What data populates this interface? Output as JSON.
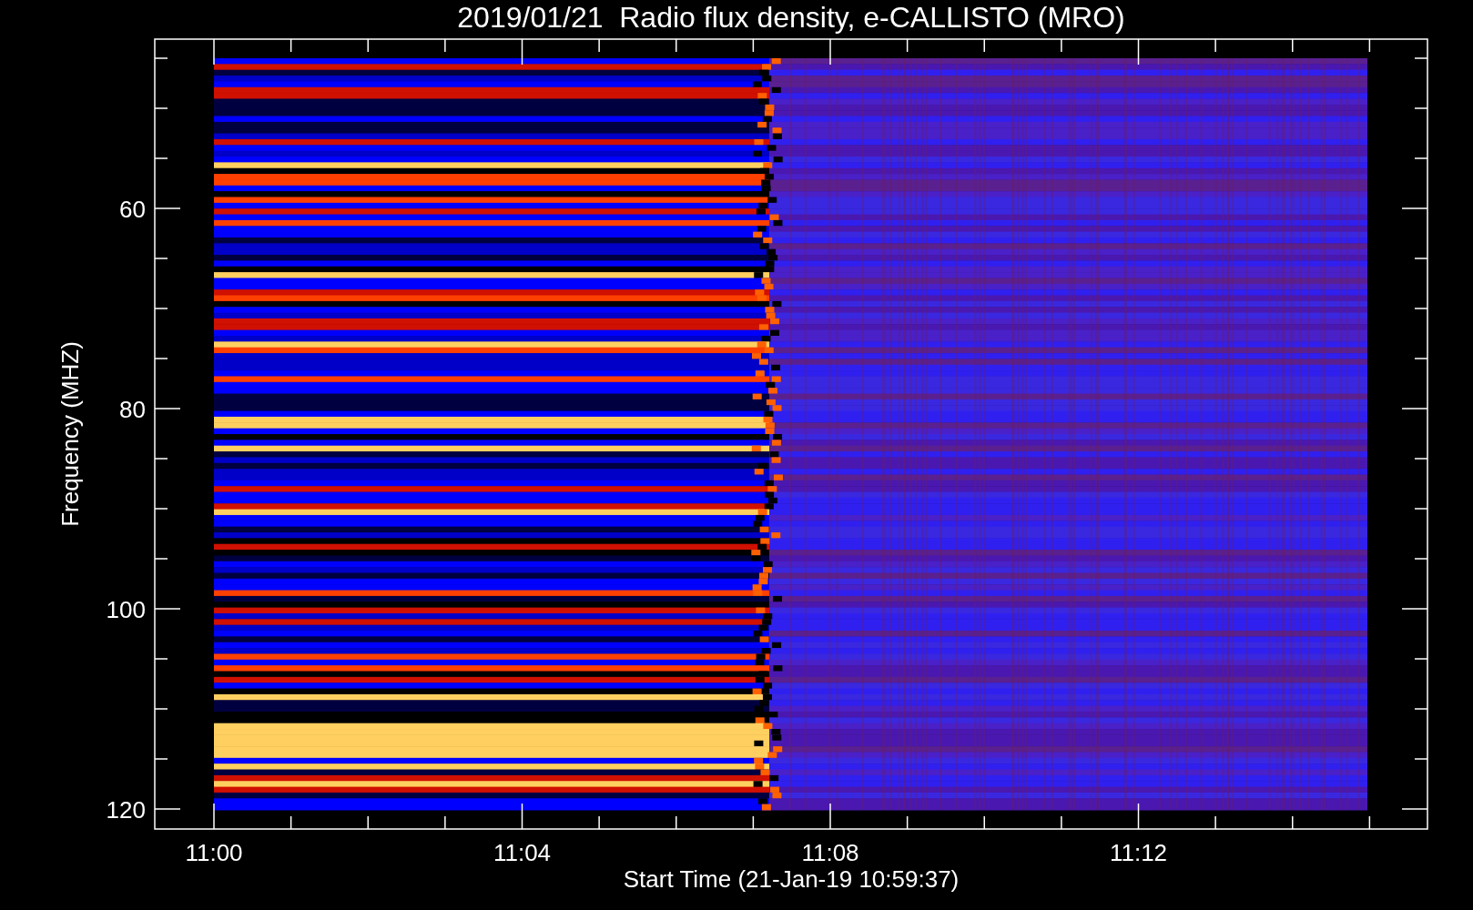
{
  "title": "2019/01/21  Radio flux density, e-CALLISTO (MRO)",
  "ylabel": "Frequency (MHZ)",
  "xlabel": "Start Time (21-Jan-19 10:59:37)",
  "yticks": [
    "60",
    "80",
    "100",
    "120"
  ],
  "xticks": [
    "11:00",
    "11:04",
    "11:08",
    "11:12"
  ]
}
